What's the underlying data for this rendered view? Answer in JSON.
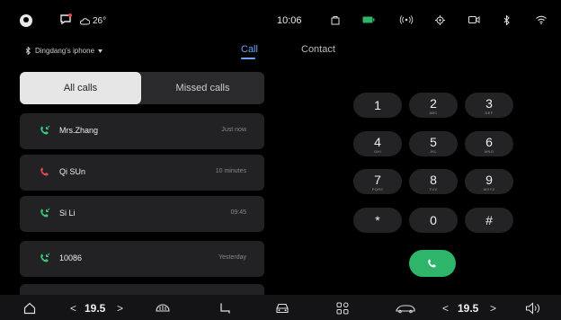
{
  "status_bar": {
    "weather": "26°",
    "time": "10:06",
    "icons": [
      "user-icon",
      "message-icon",
      "cloud-icon",
      "bag-icon",
      "battery-icon",
      "signal-broadcast-icon",
      "location-icon",
      "camera-icon",
      "bluetooth-icon",
      "wifi-icon"
    ]
  },
  "bluetooth": {
    "device_name": "Dingdang's iphone"
  },
  "tabs": {
    "call": "Call",
    "contact": "Contact"
  },
  "segment": {
    "all_calls": "All calls",
    "missed_calls": "Missed calls"
  },
  "calls": [
    {
      "name": "Mrs.Zhang",
      "time": "Just now",
      "type": "incoming"
    },
    {
      "name": "Qi SUn",
      "time": "10 minutes",
      "type": "missed"
    },
    {
      "name": "Si Li",
      "time": "09:45",
      "type": "incoming"
    },
    {
      "name": "10086",
      "time": "Yesterday",
      "type": "incoming"
    }
  ],
  "keypad": [
    {
      "digit": "1",
      "letters": ""
    },
    {
      "digit": "2",
      "letters": "ABC"
    },
    {
      "digit": "3",
      "letters": "DEF"
    },
    {
      "digit": "4",
      "letters": "GHI"
    },
    {
      "digit": "5",
      "letters": "JKL"
    },
    {
      "digit": "6",
      "letters": "MNO"
    },
    {
      "digit": "7",
      "letters": "PQRS"
    },
    {
      "digit": "8",
      "letters": "TUV"
    },
    {
      "digit": "9",
      "letters": "WXYZ"
    },
    {
      "digit": "*",
      "letters": ""
    },
    {
      "digit": "0",
      "letters": ""
    },
    {
      "digit": "#",
      "letters": ""
    }
  ],
  "dock": {
    "left_temp": "19.5",
    "right_temp": "19.5",
    "decrease": "<",
    "increase": ">"
  },
  "colors": {
    "accent": "#6aa4f5",
    "call_green": "#2fb56a",
    "missed_red": "#e5484d",
    "incoming_green": "#3cc47c"
  }
}
